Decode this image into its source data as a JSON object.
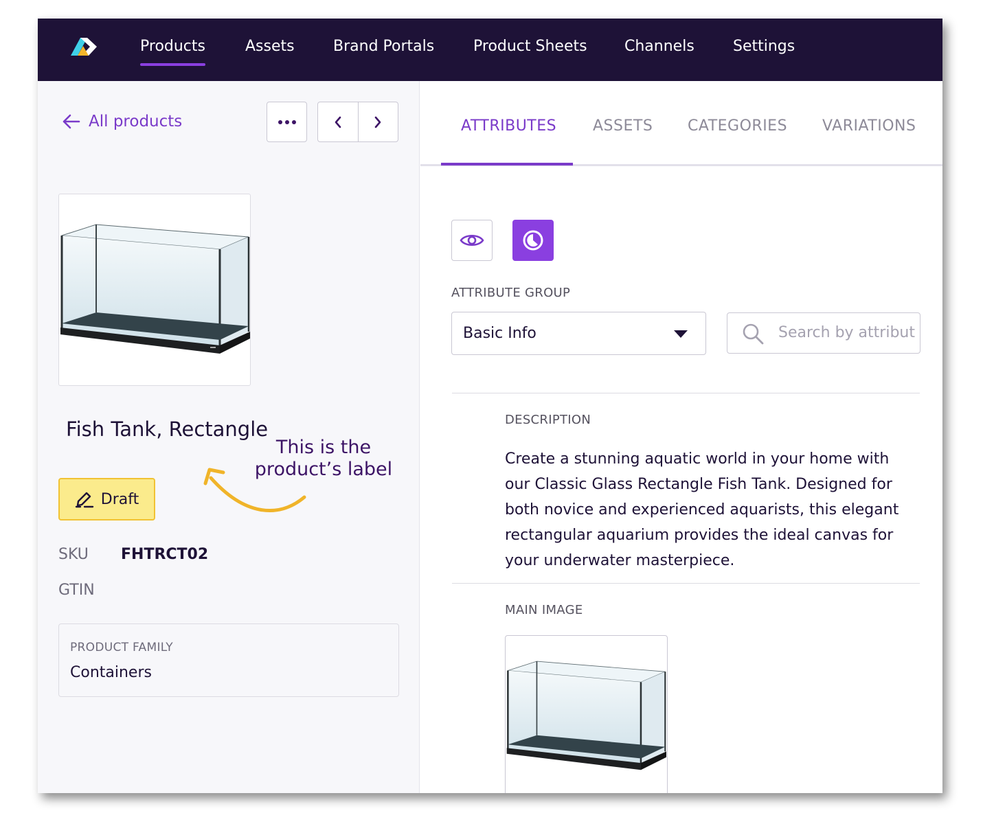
{
  "navbar": {
    "items": [
      {
        "label": "Products",
        "active": true
      },
      {
        "label": "Assets",
        "active": false
      },
      {
        "label": "Brand Portals",
        "active": false
      },
      {
        "label": "Product Sheets",
        "active": false
      },
      {
        "label": "Channels",
        "active": false
      },
      {
        "label": "Settings",
        "active": false
      }
    ]
  },
  "left": {
    "back_label": "All products",
    "more_icon": "more-horizontal-icon",
    "prev_icon": "chevron-left-icon",
    "next_icon": "chevron-right-icon",
    "product_title": "Fish Tank, Rectangle",
    "annotation": "This is the product’s label",
    "status": "Draft",
    "sku_label": "SKU",
    "sku_value": "FHTRCT02",
    "gtin_label": "GTIN",
    "gtin_value": "",
    "family_label": "PRODUCT FAMILY",
    "family_value": "Containers"
  },
  "right": {
    "tabs": [
      {
        "label": "ATTRIBUTES",
        "active": true
      },
      {
        "label": "ASSETS",
        "active": false
      },
      {
        "label": "CATEGORIES",
        "active": false
      },
      {
        "label": "VARIATIONS",
        "active": false
      }
    ],
    "view_buttons": [
      "eye-icon",
      "history-icon"
    ],
    "attribute_group_label": "ATTRIBUTE GROUP",
    "attribute_group_value": "Basic Info",
    "search_placeholder": "Search by attribute",
    "description_label": "DESCRIPTION",
    "description_text": "Create a stunning aquatic world in your home with our Classic Glass Rectangle Fish Tank. Designed for both novice and experienced aquarists, this elegant rectangular aquarium provides the ideal canvas for your underwater masterpiece.",
    "main_image_label": "MAIN IMAGE"
  },
  "colors": {
    "nav_bg": "#1e1237",
    "accent": "#7a3ac9",
    "draft_bg": "#fbeb8c",
    "annotation_arrow": "#f0b429"
  }
}
